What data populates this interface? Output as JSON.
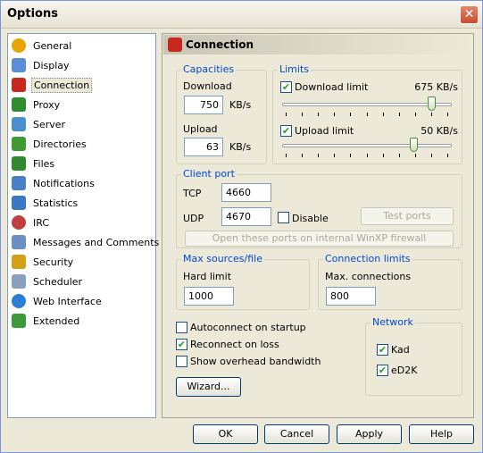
{
  "window": {
    "title": "Options",
    "close_glyph": "✕"
  },
  "sidebar": {
    "items": [
      {
        "label": "General",
        "icon": "gear-icon",
        "color": "#e8a400"
      },
      {
        "label": "Display",
        "icon": "display-icon",
        "color": "#5b8ed8"
      },
      {
        "label": "Connection",
        "icon": "connection-icon",
        "color": "#c8281e",
        "selected": true
      },
      {
        "label": "Proxy",
        "icon": "proxy-icon",
        "color": "#2d8c2d"
      },
      {
        "label": "Server",
        "icon": "server-icon",
        "color": "#4a8fd0"
      },
      {
        "label": "Directories",
        "icon": "folder-icon",
        "color": "#3f9a32"
      },
      {
        "label": "Files",
        "icon": "files-icon",
        "color": "#2f8a2f"
      },
      {
        "label": "Notifications",
        "icon": "notifications-icon",
        "color": "#4c7ec6"
      },
      {
        "label": "Statistics",
        "icon": "statistics-icon",
        "color": "#3a78c3"
      },
      {
        "label": "IRC",
        "icon": "irc-icon",
        "color": "#c04040"
      },
      {
        "label": "Messages and Comments",
        "icon": "messages-icon",
        "color": "#6a8fc4"
      },
      {
        "label": "Security",
        "icon": "lock-icon",
        "color": "#d4a017"
      },
      {
        "label": "Scheduler",
        "icon": "calendar-icon",
        "color": "#8aa0c0"
      },
      {
        "label": "Web Interface",
        "icon": "globe-icon",
        "color": "#2a7fd4"
      },
      {
        "label": "Extended",
        "icon": "extended-icon",
        "color": "#3c9a3c"
      }
    ]
  },
  "panel": {
    "title": "Connection",
    "capacities": {
      "legend": "Capacities",
      "download_label": "Download",
      "download_value": "750",
      "download_unit": "KB/s",
      "upload_label": "Upload",
      "upload_value": "63",
      "upload_unit": "KB/s"
    },
    "limits": {
      "legend": "Limits",
      "download_label": "Download limit",
      "download_checked": "✔",
      "download_value": "675 KB/s",
      "download_slider_fraction": 0.9,
      "upload_label": "Upload limit",
      "upload_checked": "✔",
      "upload_value": "50 KB/s",
      "upload_slider_fraction": 0.79
    },
    "client_port": {
      "legend": "Client port",
      "tcp_label": "TCP",
      "tcp_value": "4660",
      "udp_label": "UDP",
      "udp_value": "4670",
      "disable_label": "Disable",
      "test_ports_label": "Test ports",
      "firewall_label": "Open these ports on internal WinXP firewall"
    },
    "max_sources": {
      "legend": "Max sources/file",
      "hard_limit_label": "Hard limit",
      "hard_limit_value": "1000"
    },
    "connection_limits": {
      "legend": "Connection limits",
      "max_connections_label": "Max. connections",
      "max_connections_value": "800"
    },
    "options": {
      "autoconnect_label": "Autoconnect on startup",
      "reconnect_label": "Reconnect on loss",
      "reconnect_checked": "✔",
      "overhead_label": "Show overhead bandwidth"
    },
    "network": {
      "legend": "Network",
      "kad_label": "Kad",
      "kad_checked": "✔",
      "ed2k_label": "eD2K",
      "ed2k_checked": "✔"
    },
    "wizard_label": "Wizard..."
  },
  "footer": {
    "ok_label": "OK",
    "cancel_label": "Cancel",
    "apply_label": "Apply",
    "help_label": "Help"
  }
}
